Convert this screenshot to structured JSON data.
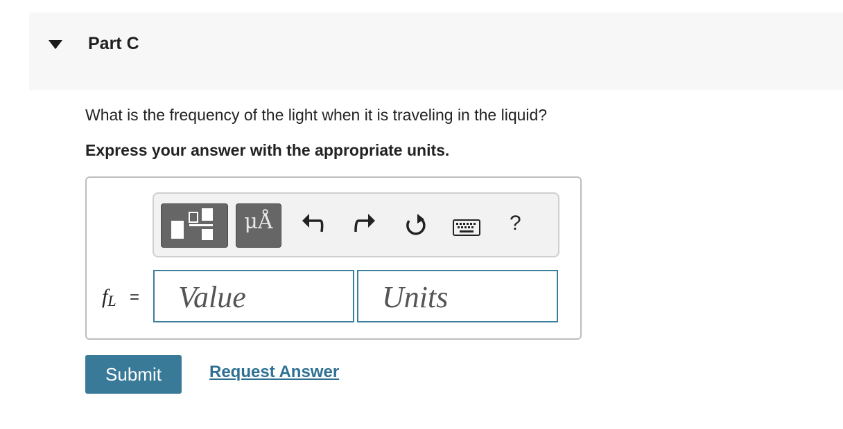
{
  "part": {
    "title": "Part C"
  },
  "question": "What is the frequency of the light when it is traveling in the liquid?",
  "instruction": "Express your answer with the appropriate units.",
  "toolbar": {
    "units_label": "μÅ",
    "help_label": "?",
    "icons": [
      "templates-icon",
      "units-icon",
      "undo-icon",
      "redo-icon",
      "reset-icon",
      "keyboard-icon",
      "help-icon"
    ]
  },
  "answer": {
    "variable": "f",
    "subscript": "L",
    "equals": "=",
    "value_placeholder": "Value",
    "units_placeholder": "Units"
  },
  "actions": {
    "submit_label": "Submit",
    "request_label": "Request Answer"
  },
  "colors": {
    "accent": "#3a7a99",
    "link": "#2e7093",
    "field_border": "#3a7f9c",
    "header_bg": "#f7f7f7"
  }
}
